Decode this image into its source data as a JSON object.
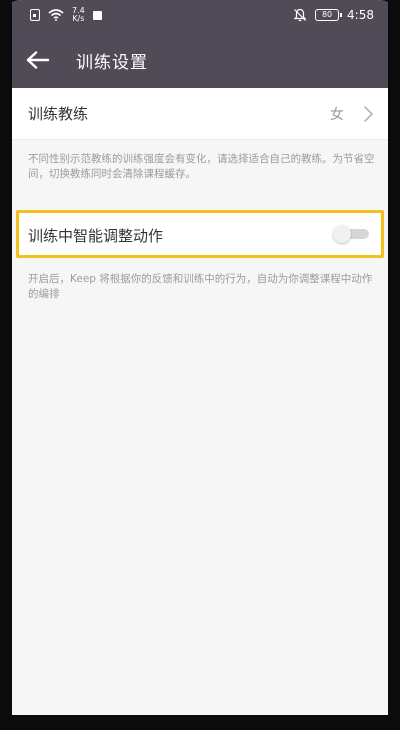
{
  "status_bar": {
    "net_speed_value": "7.4",
    "net_speed_unit": "K/s",
    "battery": "80",
    "time": "4:58"
  },
  "app_bar": {
    "title": "训练设置"
  },
  "settings": {
    "coach_label": "训练教练",
    "coach_value": "女",
    "coach_hint": "不同性别示范教练的训练强度会有变化，请选择适合自己的教练。为节省空间，切换教练同时会清除课程缓存。",
    "smart_adjust_label": "训练中智能调整动作",
    "smart_adjust_on": false,
    "smart_adjust_hint": "开启后，Keep 将根据你的反馈和训练中的行为，自动为你调整课程中动作的编排"
  },
  "colors": {
    "header": "#514b57",
    "highlight": "#f2c21b",
    "background": "#f6f6f6"
  }
}
